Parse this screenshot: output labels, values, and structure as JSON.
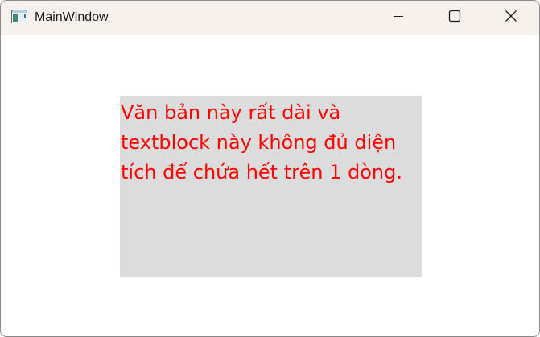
{
  "window": {
    "title": "MainWindow",
    "icon": "app-window-icon",
    "controls": {
      "minimize": "minimize-icon",
      "maximize": "maximize-icon",
      "close": "close-icon"
    }
  },
  "content": {
    "textblock_text": "Văn bản này rất dài và textblock này không đủ diện tích để chứa hết trên 1 dòng.",
    "textblock_color": "#ff0000",
    "textblock_background": "#dcdcdc"
  },
  "colors": {
    "titlebar_background": "#f6f1ec",
    "window_background": "#ffffff"
  }
}
